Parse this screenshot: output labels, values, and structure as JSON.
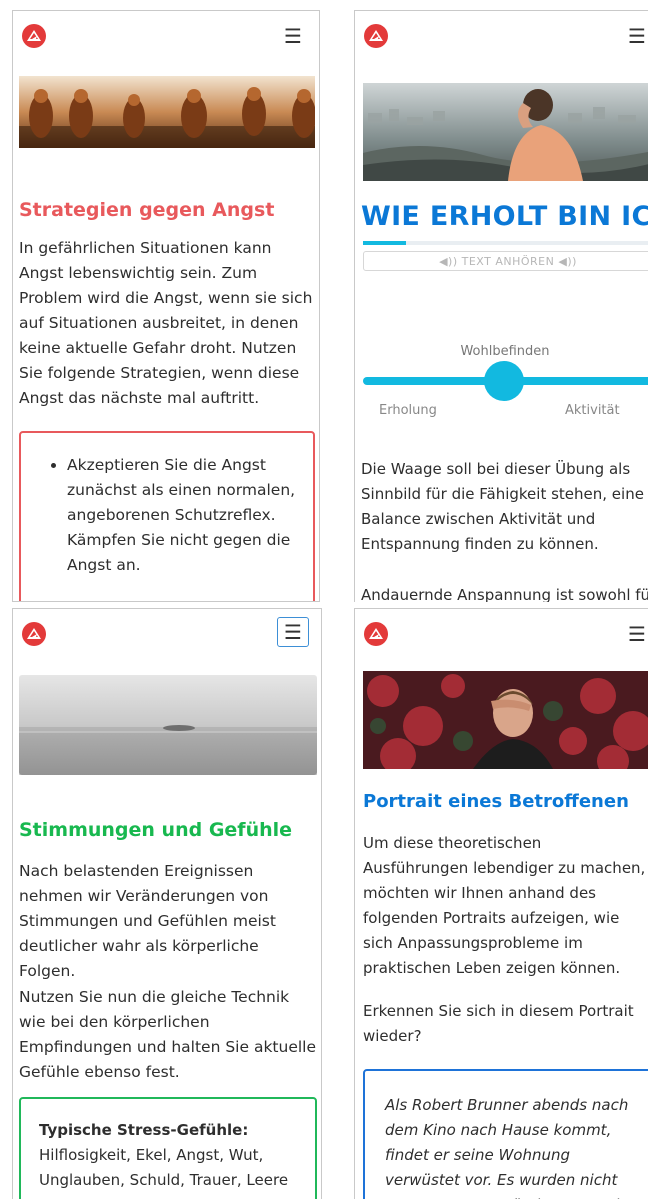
{
  "colors": {
    "red": "#e8595c",
    "blue_title": "#0b78d6",
    "cyan": "#12b9e0",
    "green": "#18b84f",
    "logo": "#e33a3a"
  },
  "panel1": {
    "logo_icon": "brand-logo-icon",
    "menu_icon": "hamburger-menu-icon",
    "menu_glyph": "☰",
    "title": "Strategien gegen Angst",
    "paragraph": "In gefährlichen Situationen kann Angst lebenswichtig sein. Zum Problem wird die Angst, wenn sie sich auf Situationen ausbreitet, in denen keine aktuelle Gefahr droht. Nutzen Sie folgende Strategien, wenn diese Angst das nächste mal auftritt.",
    "list_item": "Akzeptieren Sie die Angst zunächst als einen normalen, angeborenen Schutzreflex. Kämpfen Sie nicht gegen die Angst an."
  },
  "panel2": {
    "menu_glyph": "☰",
    "title": "WIE ERHOLT BIN ICH?",
    "progress": 0.15,
    "listen_label": "◀)) TEXT ANHÖREN ◀))",
    "slider_label": "Wohlbefinden",
    "slider_value": 0.5,
    "left_label": "Erholung",
    "right_label": "Aktivität",
    "paragraph": "Die Waage soll bei dieser Übung als Sinnbild für die Fähigkeit stehen, eine Balance zwischen Aktivität und Entspannung finden zu können.",
    "paragraph_cut": "Andauernde Anspannung ist sowohl für"
  },
  "panel3": {
    "menu_glyph": "☰",
    "title": "Stimmungen und Gefühle",
    "paragraph1": "Nach belastenden Ereignissen nehmen wir Veränderungen von Stimmungen und Gefühlen meist deutlicher wahr als körperliche Folgen.",
    "paragraph2": "Nutzen Sie nun die gleiche Technik wie bei den körperlichen Empfindungen und halten Sie aktuelle Gefühle ebenso fest.",
    "box_title": "Typische Stress-Gefühle:",
    "box_text": "Hilflosigkeit, Ekel, Angst, Wut, Unglauben, Schuld, Trauer, Leere"
  },
  "panel4": {
    "menu_glyph": "☰",
    "title": "Portrait eines Betroffenen",
    "paragraph1": "Um diese theoretischen Ausführungen lebendiger zu machen, möchten wir Ihnen anhand des folgenden Portraits aufzeigen, wie sich Anpassungsprobleme im praktischen Leben zeigen können.",
    "paragraph2": "Erkennen Sie sich in diesem Portrait wieder?",
    "quote": "Als Robert Brunner abends nach dem Kino nach Hause kommt, findet er seine Wohnung verwüstet vor. Es wurden nicht nur Wertgegenstände entwendet"
  }
}
